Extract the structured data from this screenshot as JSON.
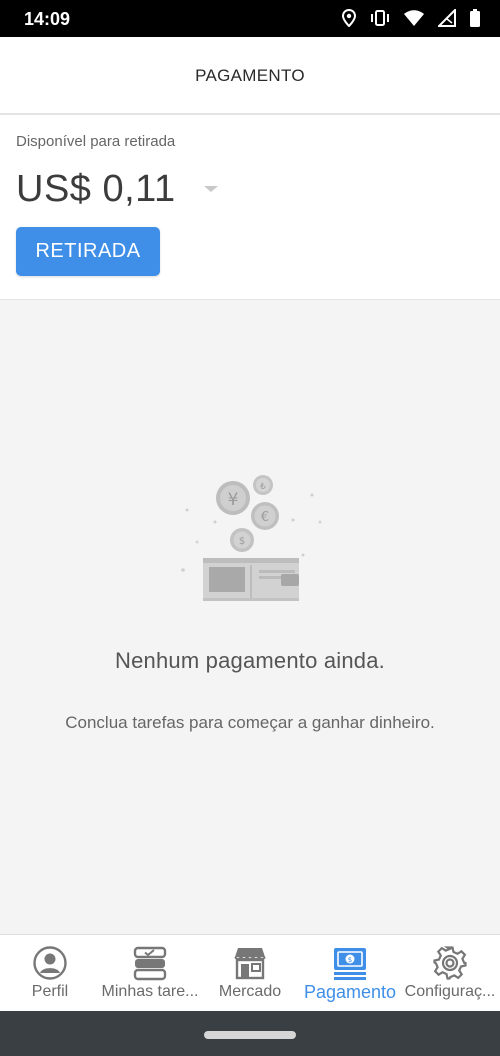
{
  "status_bar": {
    "time": "14:09",
    "icons": [
      "location-icon",
      "vibrate-icon",
      "wifi-icon",
      "signal-icon",
      "battery-icon"
    ]
  },
  "header": {
    "title": "PAGAMENTO"
  },
  "balance": {
    "label": "Disponível para retirada",
    "amount": "US$ 0,11",
    "withdraw_label": "RETIRADA"
  },
  "empty_state": {
    "title": "Nenhum pagamento ainda.",
    "description": "Conclua tarefas para começar a ganhar dinheiro.",
    "illustration": "coins-and-wallet-illustration"
  },
  "bottom_nav": {
    "items": [
      {
        "label": "Perfil",
        "icon": "profile-icon",
        "active": false
      },
      {
        "label": "Minhas tare...",
        "icon": "tasks-icon",
        "active": false
      },
      {
        "label": "Mercado",
        "icon": "store-icon",
        "active": false
      },
      {
        "label": "Pagamento",
        "icon": "payment-icon",
        "active": true
      },
      {
        "label": "Configuraç...",
        "icon": "gear-icon",
        "active": false
      }
    ]
  },
  "colors": {
    "accent": "#3f8fe8",
    "background": "#f4f4f4",
    "status_bar": "#000000",
    "system_nav": "#3a3f44"
  }
}
